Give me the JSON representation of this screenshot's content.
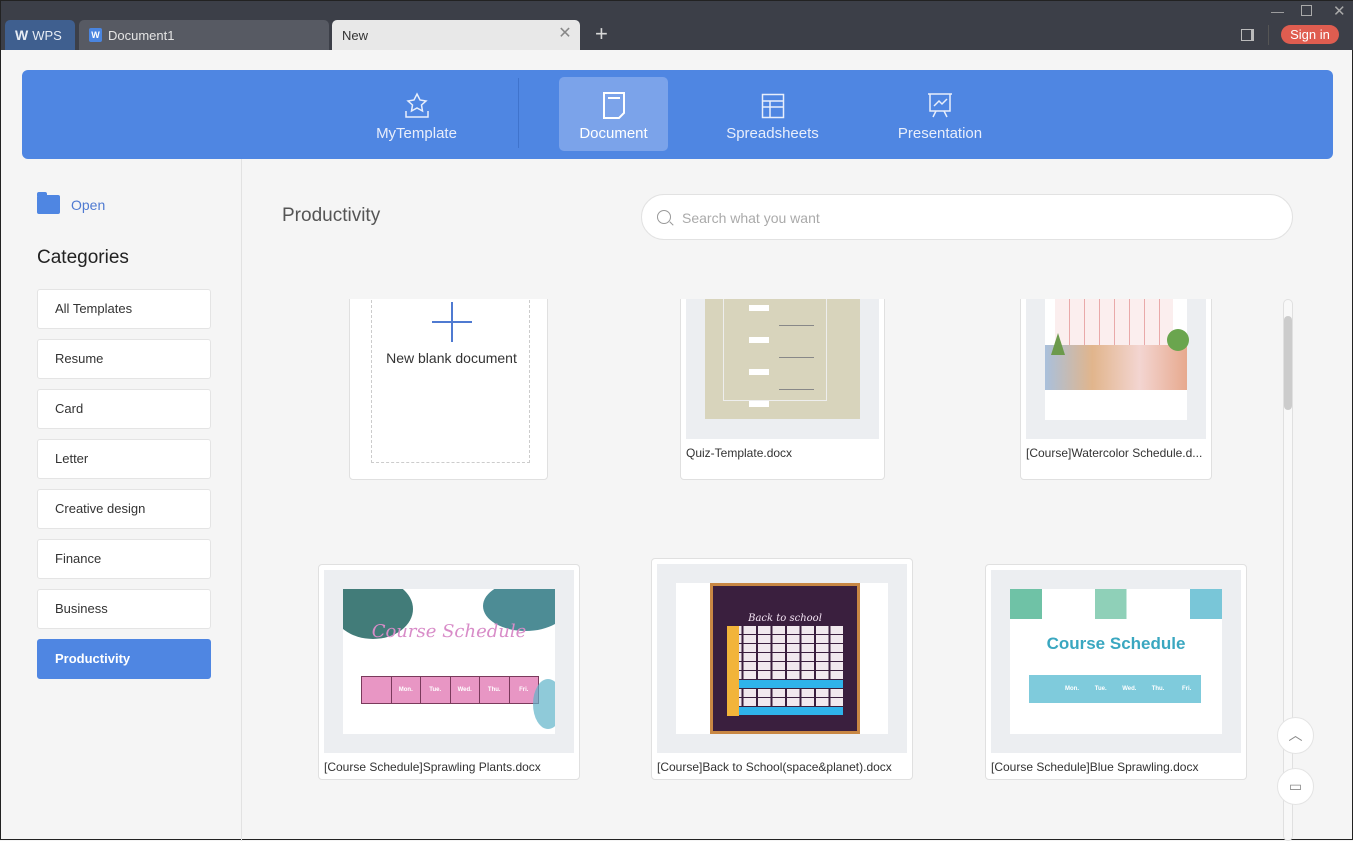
{
  "titlebar": {
    "tabs": [
      {
        "label": "WPS",
        "icon": "wps-logo-icon"
      },
      {
        "label": "Document1",
        "icon": "writer-doc-icon"
      },
      {
        "label": "New",
        "active": true
      }
    ],
    "sign_in_label": "Sign in"
  },
  "banner": {
    "tabs": [
      {
        "label": "MyTemplate",
        "icon": "star-tray-icon"
      },
      {
        "label": "Document",
        "icon": "document-icon",
        "active": true
      },
      {
        "label": "Spreadsheets",
        "icon": "spreadsheet-icon"
      },
      {
        "label": "Presentation",
        "icon": "presentation-icon"
      }
    ]
  },
  "sidebar": {
    "open_label": "Open",
    "categories_title": "Categories",
    "categories": [
      "All Templates",
      "Resume",
      "Card",
      "Letter",
      "Creative design",
      "Finance",
      "Business",
      "Productivity"
    ],
    "active_category": "Productivity"
  },
  "main": {
    "heading": "Productivity",
    "search_placeholder": "Search what you want",
    "new_blank_label": "New blank document",
    "templates": [
      {
        "name": "Quiz-Template.docx"
      },
      {
        "name": "[Course]Watercolor Schedule.d..."
      },
      {
        "name": "[Course Schedule]Sprawling Plants.docx"
      },
      {
        "name": "[Course]Back to School(space&planet).docx"
      },
      {
        "name": "[Course Schedule]Blue Sprawling.docx"
      }
    ],
    "thumb_texts": {
      "plants_title": "Course Schedule",
      "space_title": "Back to school",
      "blue_title": "Course Schedule",
      "days": [
        "Mon.",
        "Tue.",
        "Wed.",
        "Thu.",
        "Fri."
      ]
    }
  },
  "colors": {
    "accent": "#4f86e2",
    "signin": "#df5d50",
    "titlebar": "#3c3f48"
  }
}
